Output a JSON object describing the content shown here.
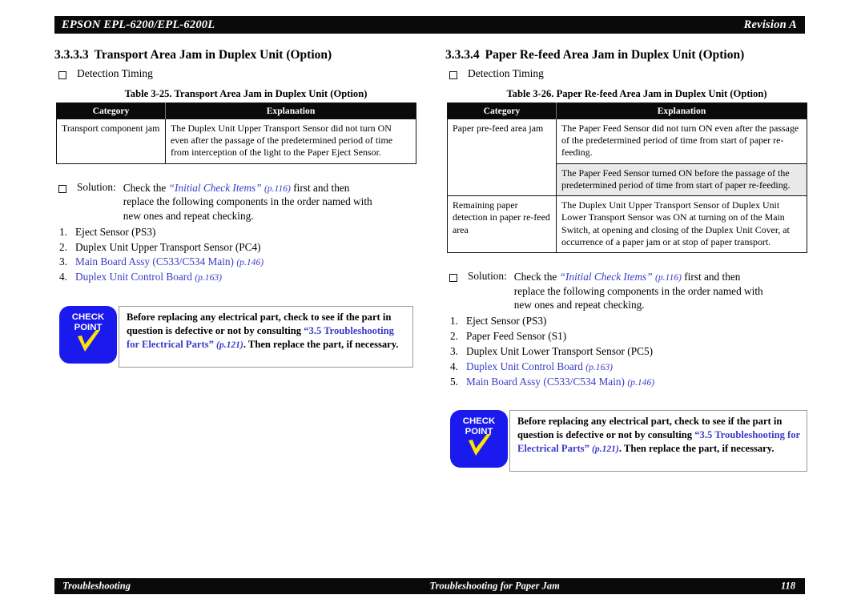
{
  "header": {
    "left": "EPSON EPL-6200/EPL-6200L",
    "right": "Revision A"
  },
  "footer": {
    "left": "Troubleshooting",
    "center": "Troubleshooting for Paper Jam",
    "page": "118"
  },
  "left_column": {
    "section_number": "3.3.3.3",
    "section_title": "Transport Area Jam in Duplex Unit (Option)",
    "detection_timing_label": "Detection Timing",
    "table_caption": "Table 3-25.  Transport Area Jam in Duplex Unit (Option)",
    "table": {
      "headers": [
        "Category",
        "Explanation"
      ],
      "rows": [
        {
          "category": "Transport component jam",
          "explanation": "The Duplex Unit Upper Transport Sensor did not turn ON even after the passage of the predetermined period of time from interception of the light to the Paper Eject Sensor.",
          "shaded": false
        }
      ]
    },
    "solution": {
      "label": "Solution:",
      "text_1": "Check the ",
      "link_initial": "“Initial Check Items”",
      "page_initial": "(p.116)",
      "text_2": " first and then replace the following components in the order named with new ones and repeat checking.",
      "steps": [
        {
          "index": "1.",
          "text": "Eject Sensor (PS3)",
          "link": false,
          "page": ""
        },
        {
          "index": "2.",
          "text": "Duplex Unit Upper Transport Sensor (PC4)",
          "link": false,
          "page": ""
        },
        {
          "index": "3.",
          "text": "Main Board Assy (C533/C534 Main)",
          "link": true,
          "page": "(p.146)"
        },
        {
          "index": "4.",
          "text": "Duplex Unit Control Board",
          "link": true,
          "page": "(p.163)"
        }
      ]
    },
    "checkpoint": {
      "badge_line_1": "CHECK",
      "badge_line_2": "POINT",
      "text_1": "Before replacing any electrical part, check to see if the part in question is defective or not by consulting ",
      "link": "“3.5 Troubleshooting for Electrical Parts”",
      "page": "(p.121)",
      "text_2": ". Then replace the part, if necessary."
    }
  },
  "right_column": {
    "section_number": "3.3.3.4",
    "section_title": "Paper Re-feed Area Jam in Duplex Unit (Option)",
    "detection_timing_label": "Detection Timing",
    "table_caption": "Table 3-26.  Paper Re-feed Area Jam in Duplex Unit (Option)",
    "table": {
      "headers": [
        "Category",
        "Explanation"
      ],
      "rows": [
        {
          "category": "Paper pre-feed area jam",
          "explanation": "The Paper Feed Sensor did not turn ON even after the passage of the predetermined period of time from start of paper re-feeding.",
          "shaded": false
        },
        {
          "category": "",
          "explanation": "The Paper Feed Sensor turned ON before the passage of the predetermined period of time from start of paper re-feeding.",
          "shaded": true
        },
        {
          "category": "Remaining paper detection in paper re-feed area",
          "explanation": "The Duplex Unit Upper Transport Sensor of Duplex Unit Lower Transport Sensor was ON at turning on of the Main Switch, at opening and closing of the Duplex Unit Cover, at occurrence of a paper jam or at stop of paper transport.",
          "shaded": false
        }
      ]
    },
    "solution": {
      "label": "Solution:",
      "text_1": "Check the ",
      "link_initial": "“Initial Check Items”",
      "page_initial": "(p.116)",
      "text_2": " first and then replace the following components in the order named with new ones and repeat checking.",
      "steps": [
        {
          "index": "1.",
          "text": "Eject Sensor (PS3)",
          "link": false,
          "page": ""
        },
        {
          "index": "2.",
          "text": "Paper Feed Sensor (S1)",
          "link": false,
          "page": ""
        },
        {
          "index": "3.",
          "text": "Duplex Unit Lower Transport Sensor (PC5)",
          "link": false,
          "page": ""
        },
        {
          "index": "4.",
          "text": "Duplex Unit Control Board",
          "link": true,
          "page": "(p.163)"
        },
        {
          "index": "5.",
          "text": "Main Board Assy (C533/C534 Main)",
          "link": true,
          "page": "(p.146)"
        }
      ]
    },
    "checkpoint": {
      "badge_line_1": "CHECK",
      "badge_line_2": "POINT",
      "text_1": "Before replacing any electrical part, check to see if the part in question is defective or not by consulting ",
      "link": "“3.5 Troubleshooting for Electrical Parts”",
      "page": "(p.121)",
      "text_2": ". Then replace the part, if necessary."
    }
  },
  "colors": {
    "bar_background": "#0a0a0a",
    "link_blue": "#3a3ac8",
    "badge_blue": "#1a1aee",
    "check_yellow": "#ffe400",
    "shaded_row": "#e9e9e9"
  }
}
